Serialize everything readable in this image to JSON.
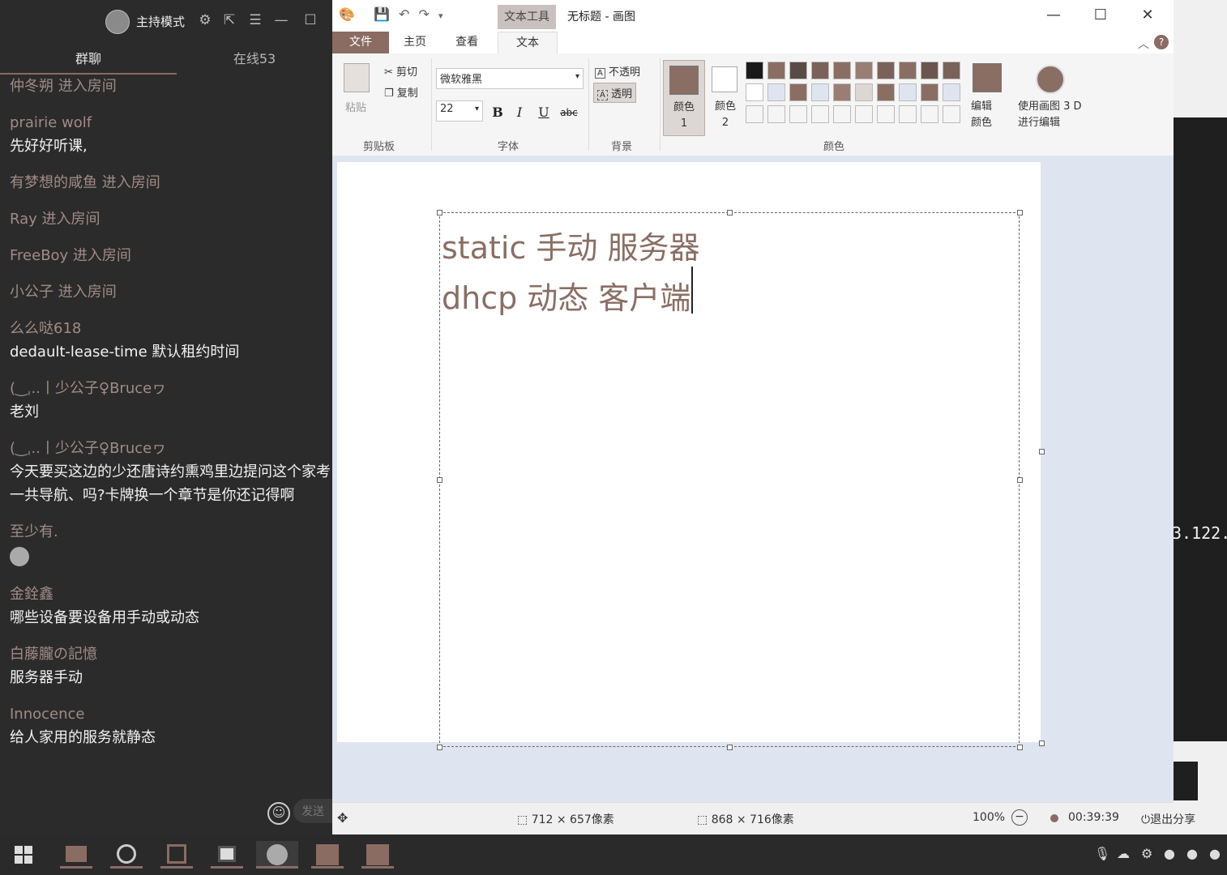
{
  "chat": {
    "host_mode_label": "主持模式",
    "tab_group": "群聊",
    "tab_online": "在线53",
    "messages": [
      {
        "sender": "仲冬朔 进入房间",
        "text": ""
      },
      {
        "sender": "prairie wolf",
        "text": "先好好听课,"
      },
      {
        "sender": "有梦想的咸鱼 进入房间",
        "text": ""
      },
      {
        "sender": "Ray 进入房间",
        "text": ""
      },
      {
        "sender": "FreeBoy 进入房间",
        "text": ""
      },
      {
        "sender": "小公子 进入房间",
        "text": ""
      },
      {
        "sender": "么么哒618",
        "text": "dedault-lease-time 默认租约时间"
      },
      {
        "sender": "(‿ˌ..丨少公子♀Bruceヮ",
        "text": "老刘"
      },
      {
        "sender": "(‿ˌ..丨少公子♀Bruceヮ",
        "text": "今天要买这边的少还唐诗约熏鸡里边提问这个家考一共导航、吗?卡牌换一个章节是你还记得啊"
      },
      {
        "sender": "至少有.",
        "text": ""
      },
      {
        "sender": "金銓鑫",
        "text": "哪些设备要设备用手动或动态"
      },
      {
        "sender": "白藤朧の記憶",
        "text": "服务器手动"
      },
      {
        "sender": "Innocence",
        "text": "给人家用的服务就静态"
      }
    ],
    "input_placeholder": "发送"
  },
  "paint": {
    "context_tab": "文本工具",
    "title": "无标题 - 画图",
    "tabs": {
      "file": "文件",
      "home": "主页",
      "view": "查看",
      "text": "文本"
    },
    "clipboard": {
      "paste": "粘贴",
      "cut": "剪切",
      "copy": "复制",
      "label": "剪贴板"
    },
    "font": {
      "family": "微软雅黑",
      "size": "22",
      "bold": "B",
      "italic": "I",
      "underline": "U",
      "strike": "abc",
      "label": "字体"
    },
    "background": {
      "opaque": "不透明",
      "transparent": "透明",
      "label": "背景"
    },
    "colors": {
      "color1_label": "颜色 1",
      "color2_label": "颜色 2",
      "edit_label": "编辑颜色",
      "paint3d_label": "使用画图 3 D 进行编辑",
      "label": "颜色",
      "color1": "#8a6e64",
      "color2": "#ffffff",
      "palette_row1": [
        "#1a1a1a",
        "#8a6e64",
        "#5a4a45",
        "#7a625a",
        "#8a6e64",
        "#9a7e74",
        "#7a625a",
        "#8a6e64",
        "#6a564f",
        "#7a625a"
      ],
      "palette_row2": [
        "#ffffff",
        "#dfe5f0",
        "#8a6e64",
        "#dfe5f0",
        "#9a7e74",
        "#dcd6d4",
        "#8a6e64",
        "#dfe5f0",
        "#8a6e64",
        "#dfe5f0"
      ]
    },
    "canvas_text": {
      "line1": "static 手动  服务器",
      "line2": "dhcp 动态  客户端"
    },
    "status": {
      "selection": "712 × 657像素",
      "canvas_size": "868 × 716像素",
      "zoom": "100%"
    }
  },
  "share": {
    "time": "00:39:39",
    "exit_label": "退出分享"
  },
  "terminal_snippet": "3.122."
}
